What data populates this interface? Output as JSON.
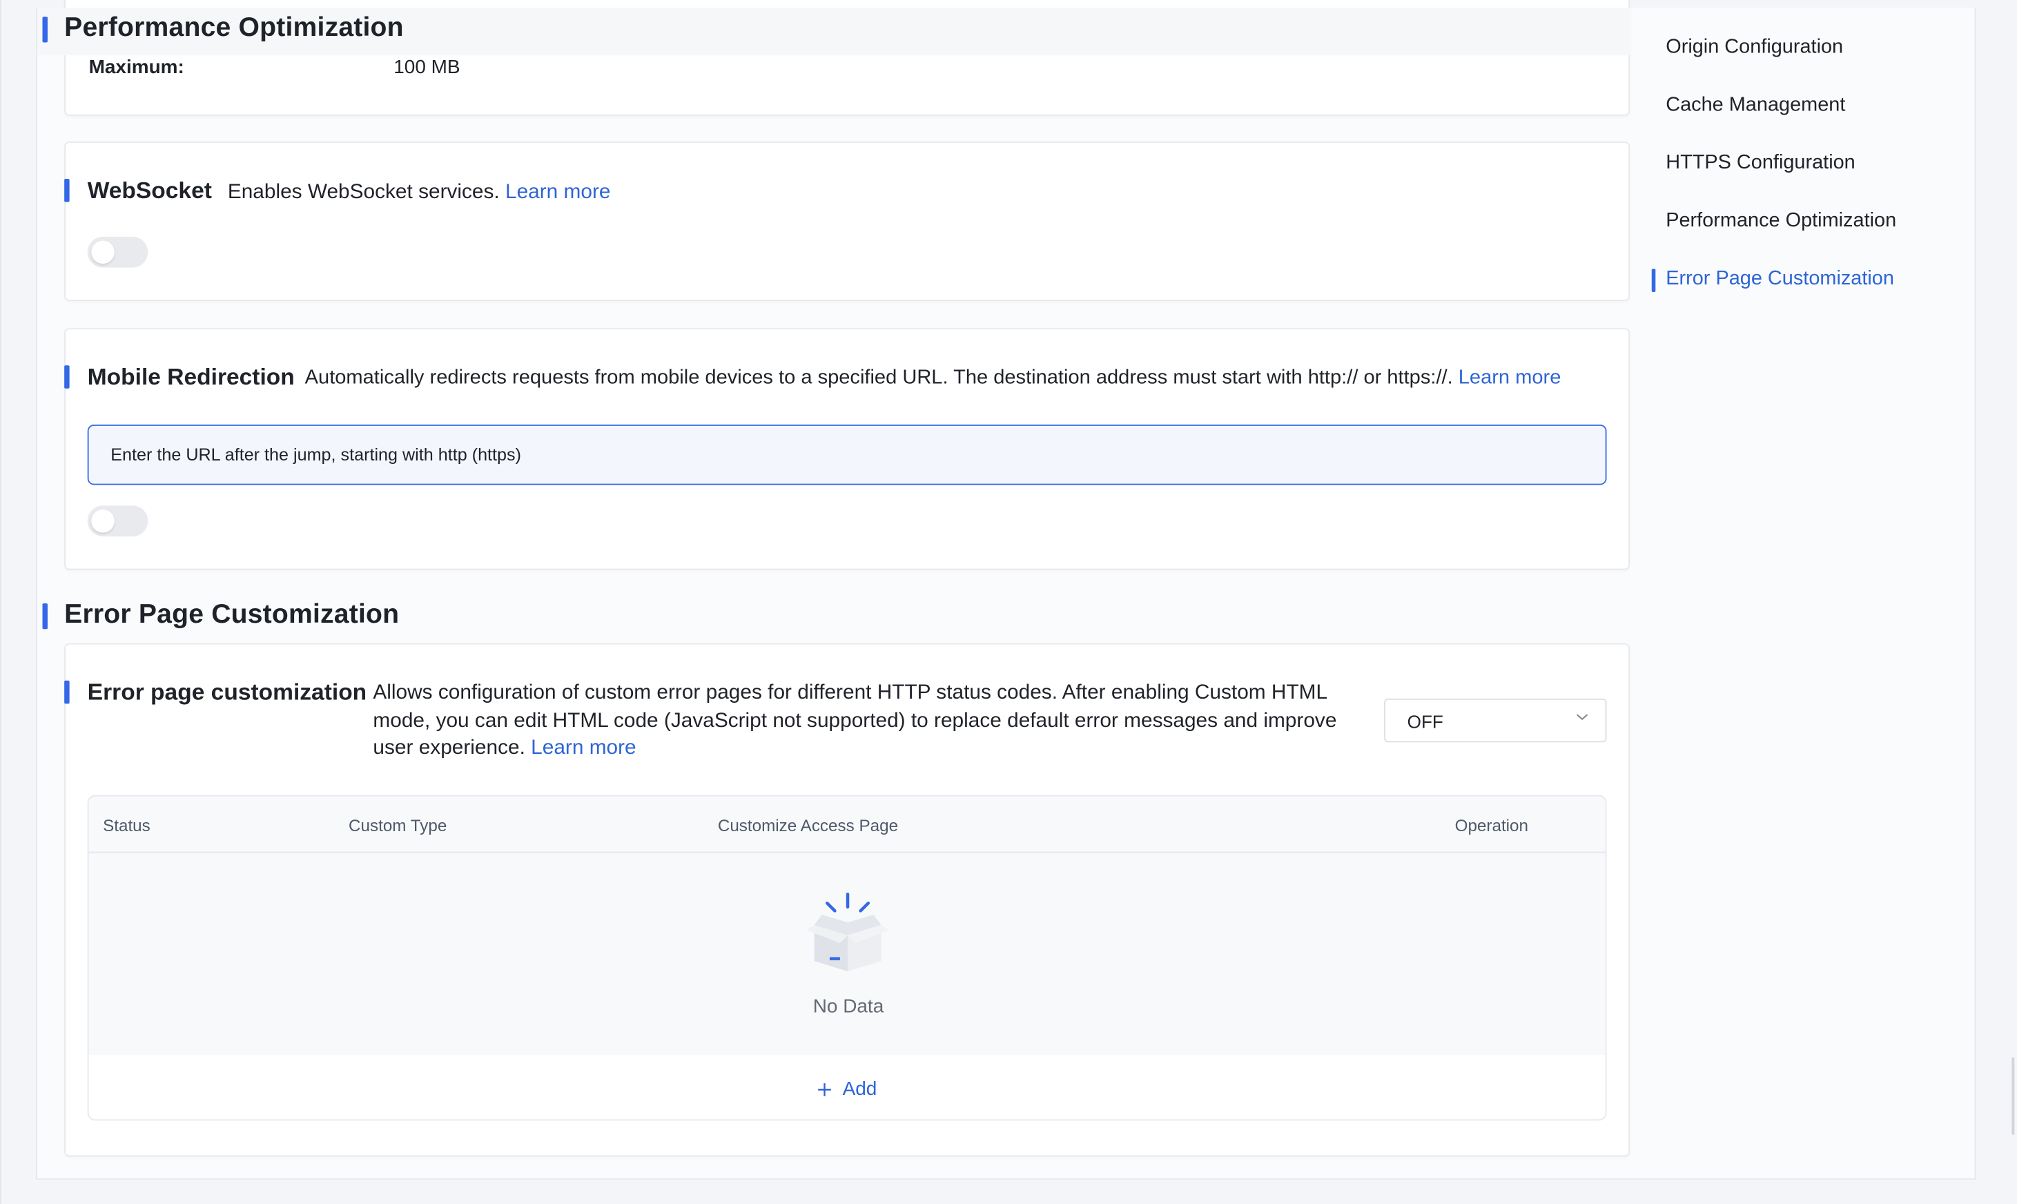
{
  "performance": {
    "section_title": "Performance Optimization",
    "maximum_label": "Maximum:",
    "maximum_value": "100 MB"
  },
  "websocket": {
    "title": "WebSocket",
    "description": "Enables WebSocket services.",
    "learn_more": "Learn more",
    "enabled": false
  },
  "mobile_redirection": {
    "title": "Mobile Redirection",
    "description": "Automatically redirects requests from mobile devices to a specified URL. The destination address must start with http:// or https://.",
    "learn_more": "Learn more",
    "url_placeholder": "Enter the URL after the jump, starting with http (https)",
    "enabled": false
  },
  "error_page": {
    "section_title": "Error Page Customization",
    "title": "Error page customization",
    "description": "Allows configuration of custom error pages for different HTTP status codes. After enabling Custom HTML mode, you can edit HTML code (JavaScript not supported) to replace default error messages and improve user experience.",
    "learn_more": "Learn more",
    "mode_value": "OFF",
    "table": {
      "columns": [
        "Status",
        "Custom Type",
        "Customize Access Page",
        "Operation"
      ],
      "empty_text": "No Data",
      "add_label": "Add"
    }
  },
  "side_nav": {
    "items": [
      {
        "label": "Origin Configuration",
        "active": false
      },
      {
        "label": "Cache Management",
        "active": false
      },
      {
        "label": "HTTPS Configuration",
        "active": false
      },
      {
        "label": "Performance Optimization",
        "active": false
      },
      {
        "label": "Error Page Customization",
        "active": true
      }
    ]
  },
  "colors": {
    "accent": "#3468e6",
    "link": "#2e64d6",
    "page_bg": "#f4f5f8"
  }
}
